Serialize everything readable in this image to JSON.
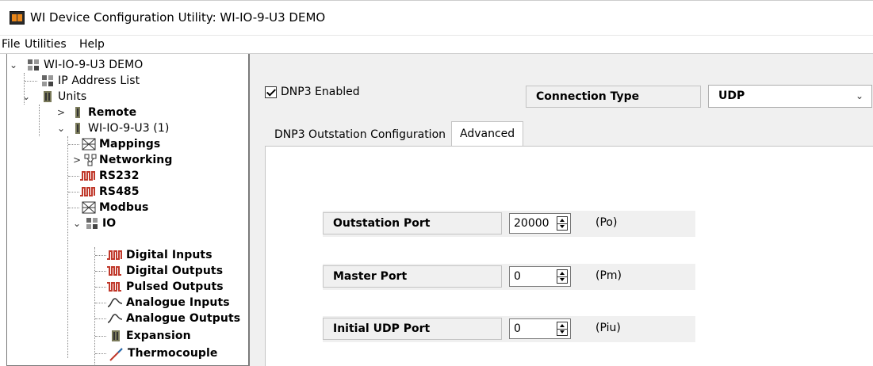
{
  "window": {
    "title": "WI Device Configuration Utility: WI-IO-9-U3 DEMO"
  },
  "menu": [
    "File",
    "Utilities",
    "Help"
  ],
  "tree": [
    {
      "label": "WI-IO-9-U3 DEMO",
      "icon": "device-icon",
      "expander": "expanded"
    },
    {
      "label": "IP Address List",
      "icon": "device-icon",
      "expander": "none"
    },
    {
      "label": "Units",
      "icon": "unit-icon",
      "expander": "expanded"
    },
    {
      "label": "Remote",
      "icon": "unit-icon",
      "expander": "collapsed"
    },
    {
      "label": "WI-IO-9-U3 (1)",
      "icon": "unit-icon",
      "expander": "expanded"
    },
    {
      "label": "Mappings",
      "icon": "mapping-icon",
      "expander": "none"
    },
    {
      "label": "Networking",
      "icon": "network-icon",
      "expander": "collapsed"
    },
    {
      "label": "RS232",
      "icon": "serial-icon",
      "expander": "none"
    },
    {
      "label": "RS485",
      "icon": "serial-icon",
      "expander": "none"
    },
    {
      "label": "Modbus",
      "icon": "mapping-icon",
      "expander": "none"
    },
    {
      "label": "IO",
      "icon": "device-icon",
      "expander": "expanded"
    },
    {
      "label": "Digital Inputs",
      "icon": "digital-input-icon",
      "expander": "none"
    },
    {
      "label": "Digital Outputs",
      "icon": "digital-output-icon",
      "expander": "none"
    },
    {
      "label": "Pulsed Outputs",
      "icon": "digital-output-icon",
      "expander": "none"
    },
    {
      "label": "Analogue Inputs",
      "icon": "analogue-icon",
      "expander": "none"
    },
    {
      "label": "Analogue Outputs",
      "icon": "analogue-icon",
      "expander": "none"
    },
    {
      "label": "Expansion",
      "icon": "unit-icon",
      "expander": "none"
    },
    {
      "label": "Thermocouple",
      "icon": "thermocouple-icon",
      "expander": "none"
    }
  ],
  "dnp3": {
    "enabled_label": "DNP3 Enabled",
    "enabled": true,
    "connection_type_label": "Connection Type",
    "connection_type_value": "UDP"
  },
  "tabs": [
    {
      "label": "DNP3 Outstation Configuration",
      "active": false
    },
    {
      "label": "Advanced",
      "active": true
    }
  ],
  "fields": [
    {
      "label": "Outstation Port",
      "value": "20000",
      "unit": "(Po)"
    },
    {
      "label": "Master Port",
      "value": "0",
      "unit": "(Pm)"
    },
    {
      "label": "Initial UDP Port",
      "value": "0",
      "unit": "(Piu)"
    }
  ],
  "colors": {
    "serial_icon": "#c0392b",
    "panel_bg": "#f0f0f0",
    "app_icon_accent": "#e8861a"
  }
}
